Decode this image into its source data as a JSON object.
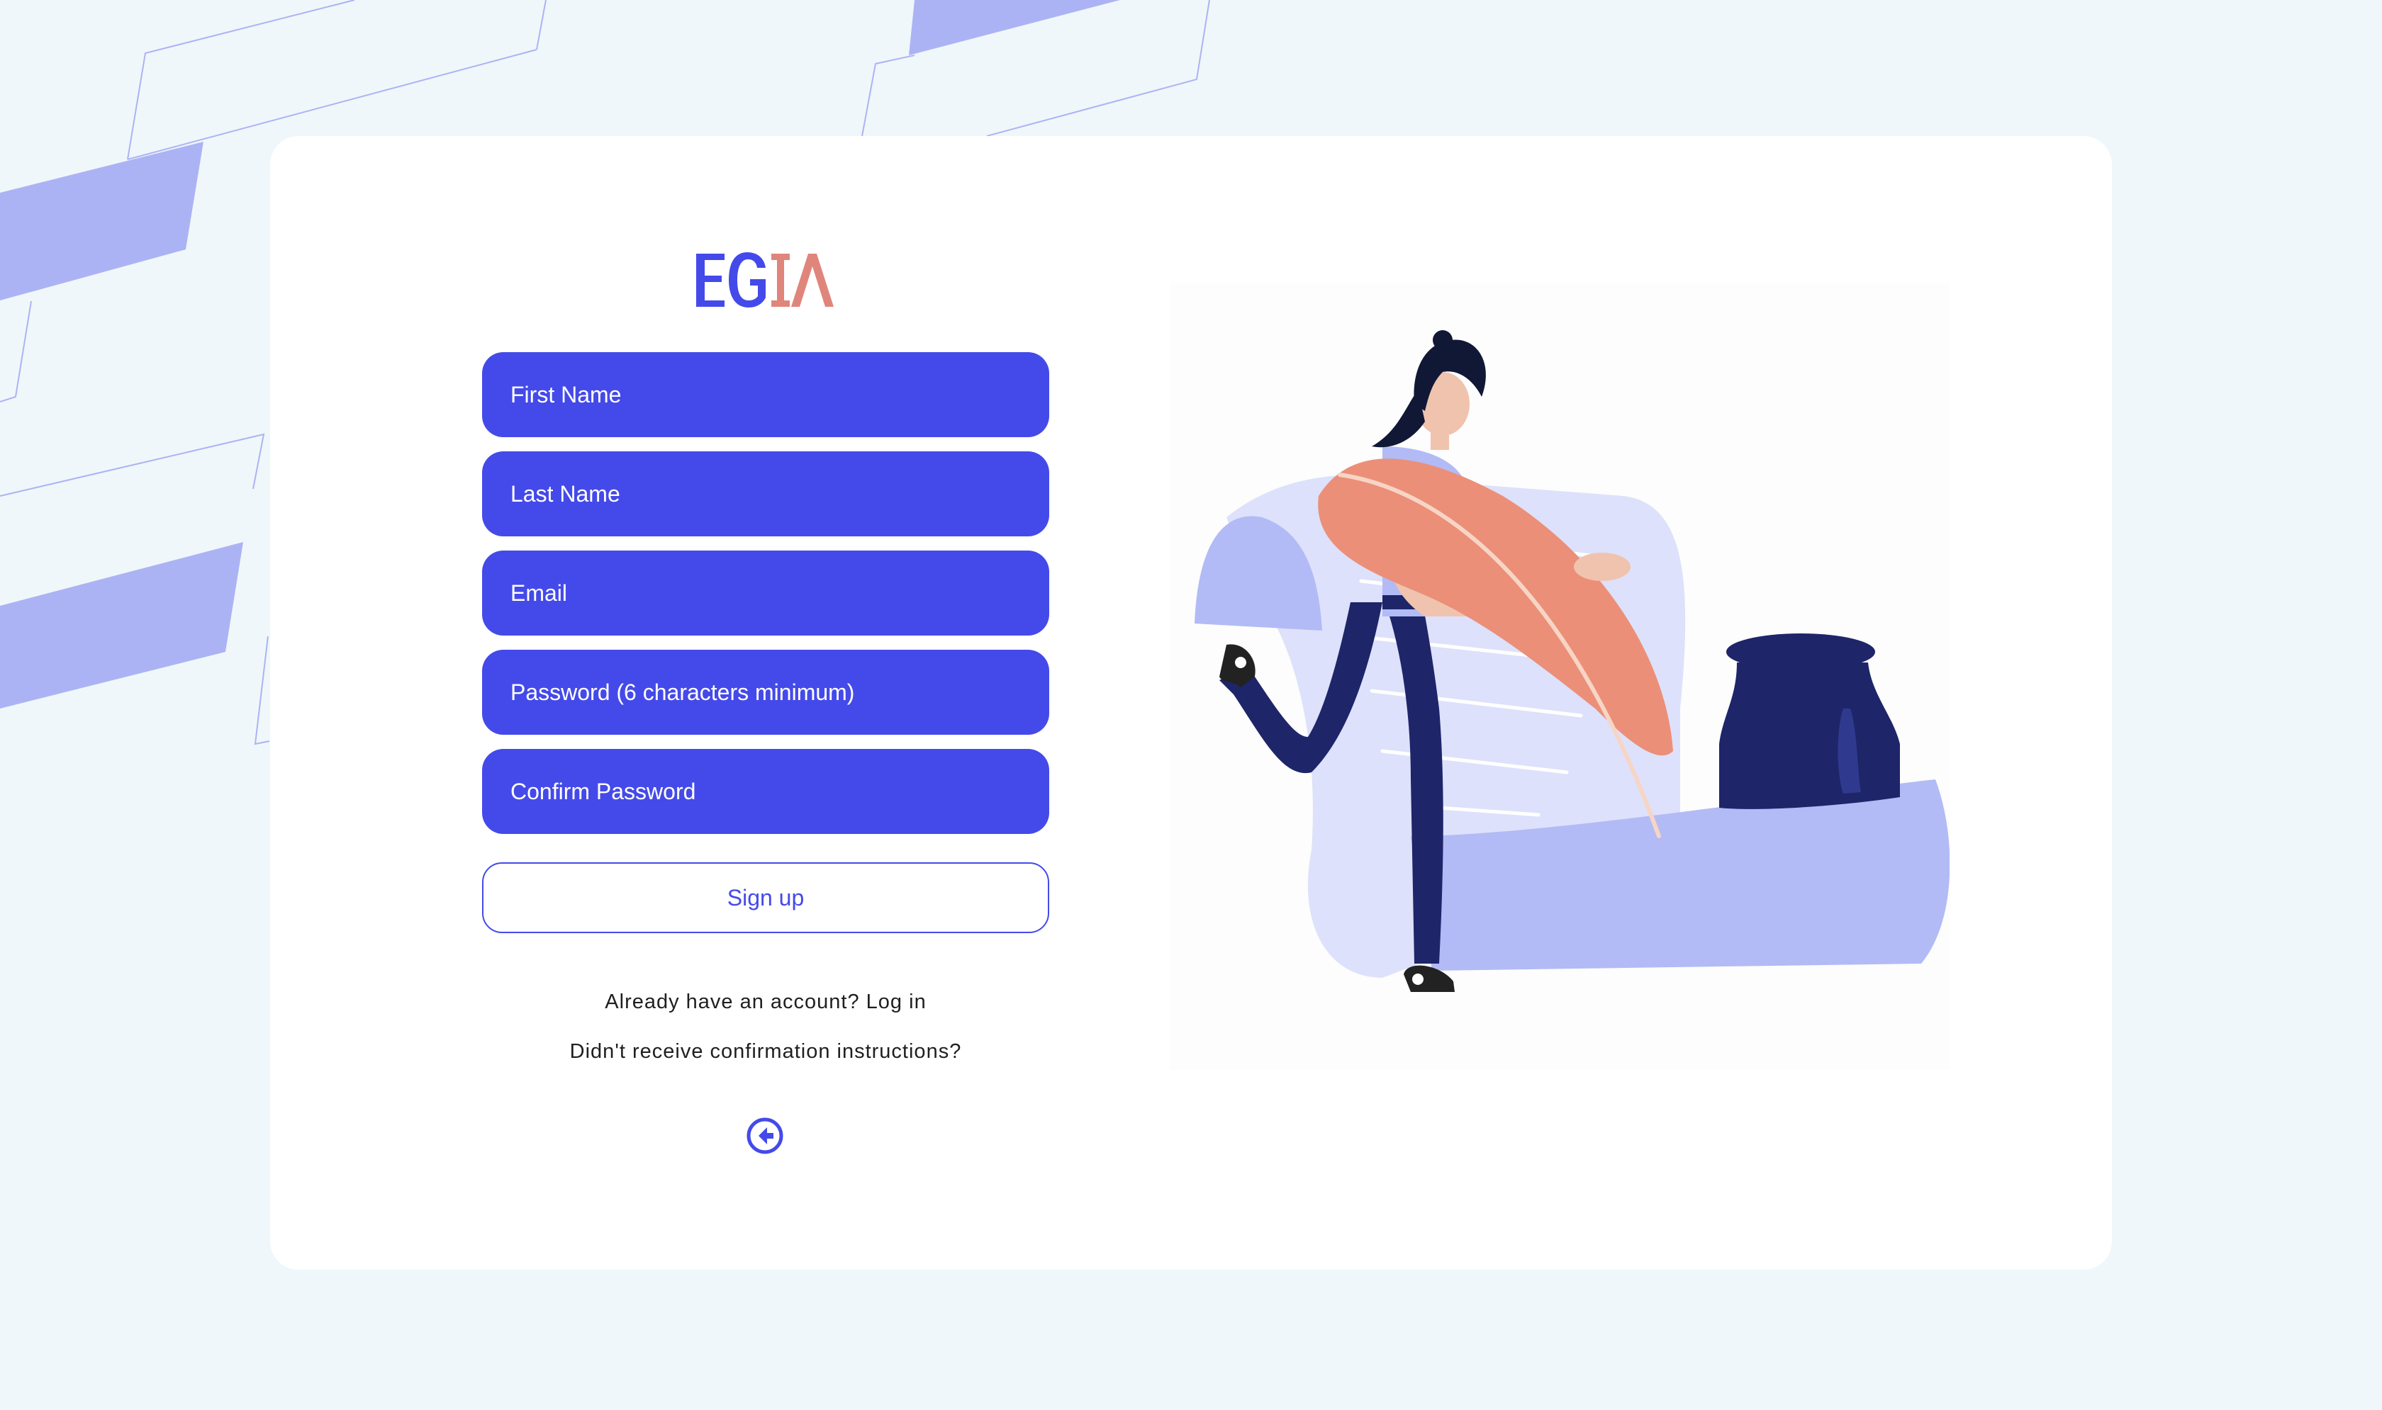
{
  "logo": {
    "text": "EGIA",
    "primary_color": "#444ae9",
    "secondary_color": "#e0857c"
  },
  "form": {
    "fields": [
      {
        "placeholder": "First Name"
      },
      {
        "placeholder": "Last Name"
      },
      {
        "placeholder": "Email"
      },
      {
        "placeholder": "Password (6 characters minimum)"
      },
      {
        "placeholder": "Confirm Password"
      }
    ],
    "submit_label": "Sign up"
  },
  "links": {
    "login": "Already have an account? Log in",
    "confirmation": "Didn't receive confirmation instructions?"
  },
  "icons": {
    "back": "arrow-left-circle-icon"
  },
  "colors": {
    "accent": "#444ae9",
    "background": "#eff7fa",
    "card": "#ffffff",
    "decor": "#acb3f4",
    "illustration_peach": "#ec8f78",
    "illustration_navy": "#1e2569"
  }
}
